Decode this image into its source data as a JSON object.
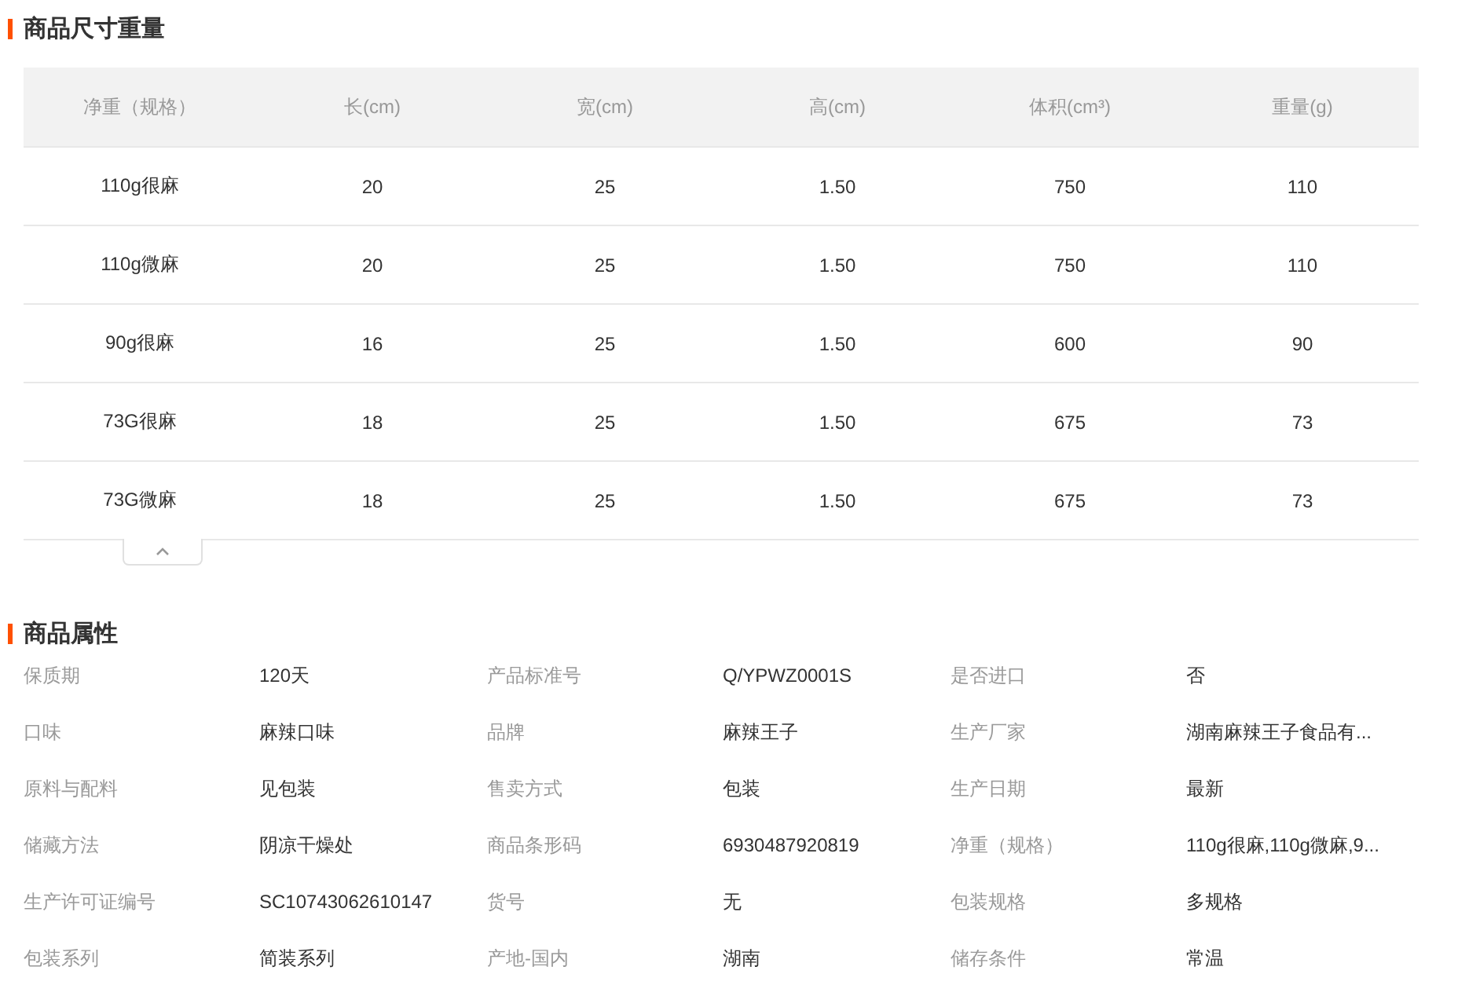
{
  "size_section": {
    "title": "商品尺寸重量",
    "table": {
      "columns": [
        "净重（规格）",
        "长(cm)",
        "宽(cm)",
        "高(cm)",
        "体积(cm³)",
        "重量(g)"
      ],
      "rows": [
        [
          "110g很麻",
          "20",
          "25",
          "1.50",
          "750",
          "110"
        ],
        [
          "110g微麻",
          "20",
          "25",
          "1.50",
          "750",
          "110"
        ],
        [
          "90g很麻",
          "16",
          "25",
          "1.50",
          "600",
          "90"
        ],
        [
          "73G很麻",
          "18",
          "25",
          "1.50",
          "675",
          "73"
        ],
        [
          "73G微麻",
          "18",
          "25",
          "1.50",
          "675",
          "73"
        ]
      ]
    },
    "expanded": true
  },
  "attributes_section": {
    "title": "商品属性",
    "items": [
      {
        "label": "保质期",
        "value": "120天"
      },
      {
        "label": "产品标准号",
        "value": "Q/YPWZ0001S"
      },
      {
        "label": "是否进口",
        "value": "否"
      },
      {
        "label": "口味",
        "value": "麻辣口味"
      },
      {
        "label": "品牌",
        "value": "麻辣王子"
      },
      {
        "label": "生产厂家",
        "value": "湖南麻辣王子食品有..."
      },
      {
        "label": "原料与配料",
        "value": "见包装"
      },
      {
        "label": "售卖方式",
        "value": "包装"
      },
      {
        "label": "生产日期",
        "value": "最新"
      },
      {
        "label": "储藏方法",
        "value": "阴凉干燥处"
      },
      {
        "label": "商品条形码",
        "value": "6930487920819"
      },
      {
        "label": "净重（规格）",
        "value": "110g很麻,110g微麻,9..."
      },
      {
        "label": "生产许可证编号",
        "value": "SC10743062610147"
      },
      {
        "label": "货号",
        "value": "无"
      },
      {
        "label": "包装规格",
        "value": "多规格"
      },
      {
        "label": "包装系列",
        "value": "简装系列"
      },
      {
        "label": "产地-国内",
        "value": "湖南"
      },
      {
        "label": "储存条件",
        "value": "常温"
      }
    ]
  }
}
